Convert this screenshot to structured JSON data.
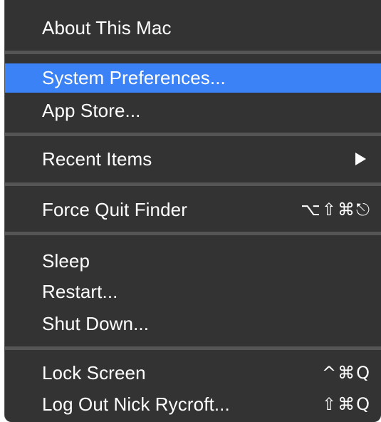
{
  "menu": {
    "about": {
      "label": "About This Mac"
    },
    "system_preferences": {
      "label": "System Preferences..."
    },
    "app_store": {
      "label": "App Store..."
    },
    "recent_items": {
      "label": "Recent Items"
    },
    "force_quit": {
      "label": "Force Quit Finder",
      "shortcut": "⌥⇧⌘⎋"
    },
    "sleep": {
      "label": "Sleep"
    },
    "restart": {
      "label": "Restart..."
    },
    "shut_down": {
      "label": "Shut Down..."
    },
    "lock_screen": {
      "label": "Lock Screen",
      "shortcut": "^⌘Q"
    },
    "log_out": {
      "label": "Log Out Nick Rycroft...",
      "shortcut": "⇧⌘Q"
    }
  },
  "colors": {
    "menu_background": "#333333",
    "highlight": "#3b82f6",
    "separator": "#555555",
    "text": "#ffffff"
  }
}
